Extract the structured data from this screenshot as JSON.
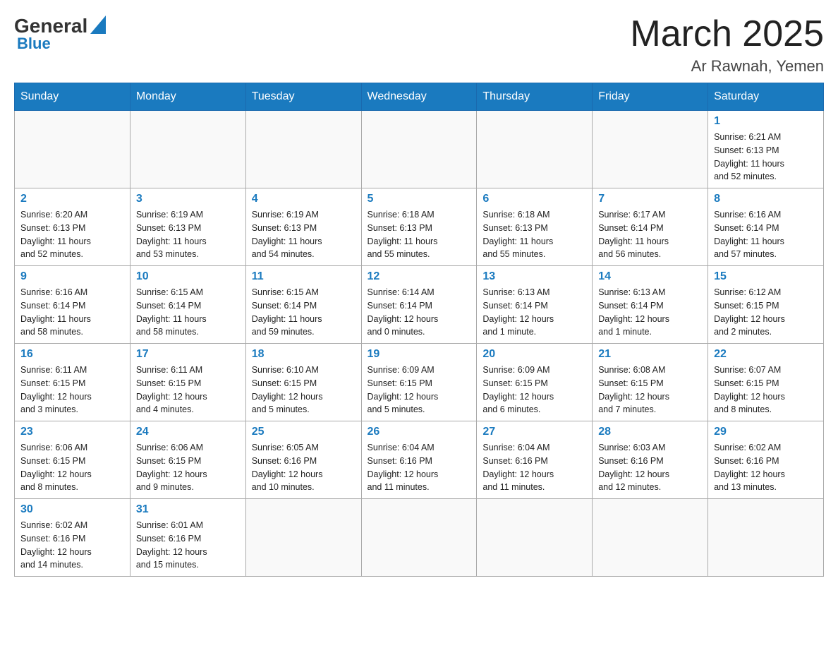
{
  "header": {
    "logo_general": "General",
    "logo_blue": "Blue",
    "month": "March 2025",
    "location": "Ar Rawnah, Yemen"
  },
  "weekdays": [
    "Sunday",
    "Monday",
    "Tuesday",
    "Wednesday",
    "Thursday",
    "Friday",
    "Saturday"
  ],
  "weeks": [
    [
      {
        "day": "",
        "info": ""
      },
      {
        "day": "",
        "info": ""
      },
      {
        "day": "",
        "info": ""
      },
      {
        "day": "",
        "info": ""
      },
      {
        "day": "",
        "info": ""
      },
      {
        "day": "",
        "info": ""
      },
      {
        "day": "1",
        "info": "Sunrise: 6:21 AM\nSunset: 6:13 PM\nDaylight: 11 hours\nand 52 minutes."
      }
    ],
    [
      {
        "day": "2",
        "info": "Sunrise: 6:20 AM\nSunset: 6:13 PM\nDaylight: 11 hours\nand 52 minutes."
      },
      {
        "day": "3",
        "info": "Sunrise: 6:19 AM\nSunset: 6:13 PM\nDaylight: 11 hours\nand 53 minutes."
      },
      {
        "day": "4",
        "info": "Sunrise: 6:19 AM\nSunset: 6:13 PM\nDaylight: 11 hours\nand 54 minutes."
      },
      {
        "day": "5",
        "info": "Sunrise: 6:18 AM\nSunset: 6:13 PM\nDaylight: 11 hours\nand 55 minutes."
      },
      {
        "day": "6",
        "info": "Sunrise: 6:18 AM\nSunset: 6:13 PM\nDaylight: 11 hours\nand 55 minutes."
      },
      {
        "day": "7",
        "info": "Sunrise: 6:17 AM\nSunset: 6:14 PM\nDaylight: 11 hours\nand 56 minutes."
      },
      {
        "day": "8",
        "info": "Sunrise: 6:16 AM\nSunset: 6:14 PM\nDaylight: 11 hours\nand 57 minutes."
      }
    ],
    [
      {
        "day": "9",
        "info": "Sunrise: 6:16 AM\nSunset: 6:14 PM\nDaylight: 11 hours\nand 58 minutes."
      },
      {
        "day": "10",
        "info": "Sunrise: 6:15 AM\nSunset: 6:14 PM\nDaylight: 11 hours\nand 58 minutes."
      },
      {
        "day": "11",
        "info": "Sunrise: 6:15 AM\nSunset: 6:14 PM\nDaylight: 11 hours\nand 59 minutes."
      },
      {
        "day": "12",
        "info": "Sunrise: 6:14 AM\nSunset: 6:14 PM\nDaylight: 12 hours\nand 0 minutes."
      },
      {
        "day": "13",
        "info": "Sunrise: 6:13 AM\nSunset: 6:14 PM\nDaylight: 12 hours\nand 1 minute."
      },
      {
        "day": "14",
        "info": "Sunrise: 6:13 AM\nSunset: 6:14 PM\nDaylight: 12 hours\nand 1 minute."
      },
      {
        "day": "15",
        "info": "Sunrise: 6:12 AM\nSunset: 6:15 PM\nDaylight: 12 hours\nand 2 minutes."
      }
    ],
    [
      {
        "day": "16",
        "info": "Sunrise: 6:11 AM\nSunset: 6:15 PM\nDaylight: 12 hours\nand 3 minutes."
      },
      {
        "day": "17",
        "info": "Sunrise: 6:11 AM\nSunset: 6:15 PM\nDaylight: 12 hours\nand 4 minutes."
      },
      {
        "day": "18",
        "info": "Sunrise: 6:10 AM\nSunset: 6:15 PM\nDaylight: 12 hours\nand 5 minutes."
      },
      {
        "day": "19",
        "info": "Sunrise: 6:09 AM\nSunset: 6:15 PM\nDaylight: 12 hours\nand 5 minutes."
      },
      {
        "day": "20",
        "info": "Sunrise: 6:09 AM\nSunset: 6:15 PM\nDaylight: 12 hours\nand 6 minutes."
      },
      {
        "day": "21",
        "info": "Sunrise: 6:08 AM\nSunset: 6:15 PM\nDaylight: 12 hours\nand 7 minutes."
      },
      {
        "day": "22",
        "info": "Sunrise: 6:07 AM\nSunset: 6:15 PM\nDaylight: 12 hours\nand 8 minutes."
      }
    ],
    [
      {
        "day": "23",
        "info": "Sunrise: 6:06 AM\nSunset: 6:15 PM\nDaylight: 12 hours\nand 8 minutes."
      },
      {
        "day": "24",
        "info": "Sunrise: 6:06 AM\nSunset: 6:15 PM\nDaylight: 12 hours\nand 9 minutes."
      },
      {
        "day": "25",
        "info": "Sunrise: 6:05 AM\nSunset: 6:16 PM\nDaylight: 12 hours\nand 10 minutes."
      },
      {
        "day": "26",
        "info": "Sunrise: 6:04 AM\nSunset: 6:16 PM\nDaylight: 12 hours\nand 11 minutes."
      },
      {
        "day": "27",
        "info": "Sunrise: 6:04 AM\nSunset: 6:16 PM\nDaylight: 12 hours\nand 11 minutes."
      },
      {
        "day": "28",
        "info": "Sunrise: 6:03 AM\nSunset: 6:16 PM\nDaylight: 12 hours\nand 12 minutes."
      },
      {
        "day": "29",
        "info": "Sunrise: 6:02 AM\nSunset: 6:16 PM\nDaylight: 12 hours\nand 13 minutes."
      }
    ],
    [
      {
        "day": "30",
        "info": "Sunrise: 6:02 AM\nSunset: 6:16 PM\nDaylight: 12 hours\nand 14 minutes."
      },
      {
        "day": "31",
        "info": "Sunrise: 6:01 AM\nSunset: 6:16 PM\nDaylight: 12 hours\nand 15 minutes."
      },
      {
        "day": "",
        "info": ""
      },
      {
        "day": "",
        "info": ""
      },
      {
        "day": "",
        "info": ""
      },
      {
        "day": "",
        "info": ""
      },
      {
        "day": "",
        "info": ""
      }
    ]
  ]
}
